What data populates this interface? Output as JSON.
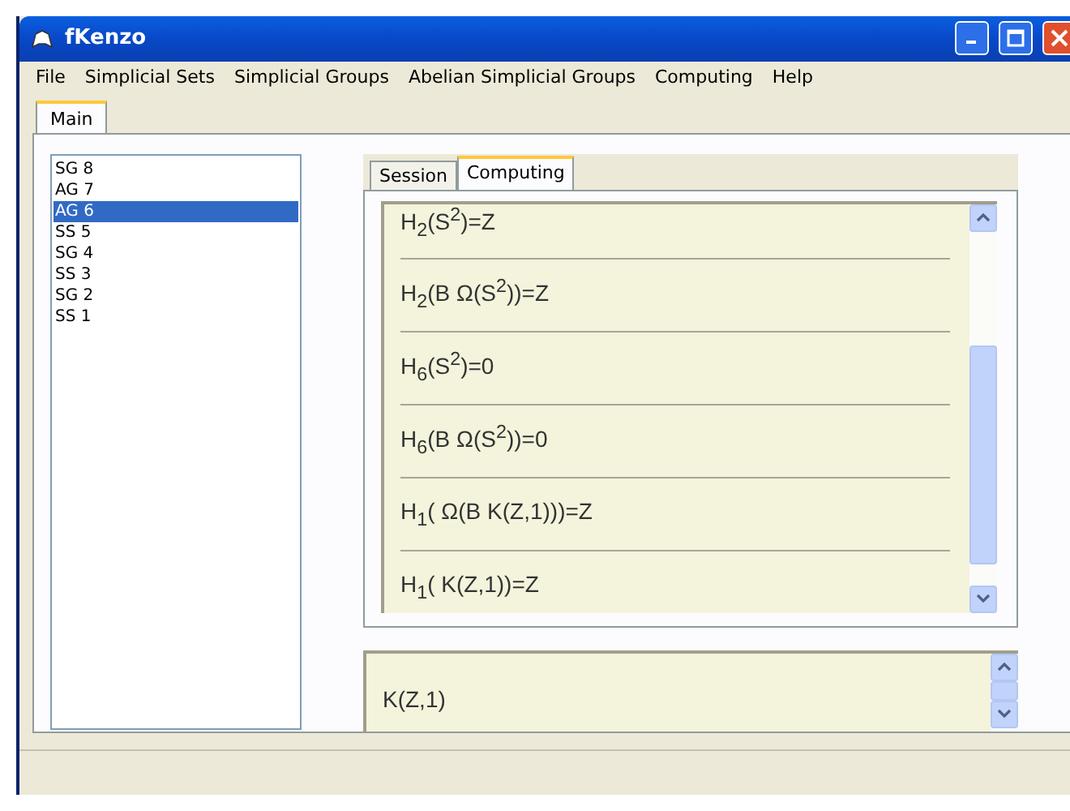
{
  "window": {
    "title": "fKenzo"
  },
  "menu": [
    "File",
    "Simplicial Sets",
    "Simplicial Groups",
    "Abelian Simplicial Groups",
    "Computing",
    "Help"
  ],
  "main_tabs": [
    {
      "label": "Main",
      "selected": true
    }
  ],
  "objects": [
    {
      "label": "SG 8",
      "selected": false
    },
    {
      "label": "AG 7",
      "selected": false
    },
    {
      "label": "AG 6",
      "selected": true
    },
    {
      "label": "SS 5",
      "selected": false
    },
    {
      "label": "SG 4",
      "selected": false
    },
    {
      "label": "SS 3",
      "selected": false
    },
    {
      "label": "SG 2",
      "selected": false
    },
    {
      "label": "SS 1",
      "selected": false
    }
  ],
  "tabs": [
    {
      "label": "Session",
      "selected": false
    },
    {
      "label": "Computing",
      "selected": true
    }
  ],
  "results": [
    "H$_{2}$(S$^{2}$)=Z",
    "H$_{2}$(B Ω(S$^{2}$))=Z",
    "H$_{6}$(S$^{2}$)=0",
    "H$_{6}$(B Ω(S$^{2}$))=0",
    "H$_{1}$( Ω(B K(Z,1)))=Z",
    "H$_{1}$( K(Z,1))=Z"
  ],
  "object_description": "K(Z,1)"
}
